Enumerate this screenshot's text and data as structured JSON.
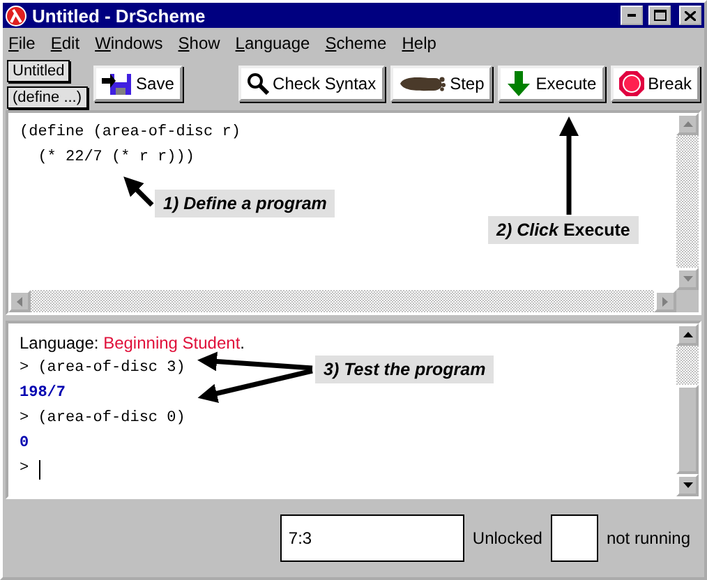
{
  "window": {
    "title": "Untitled - DrScheme"
  },
  "menu": [
    "File",
    "Edit",
    "Windows",
    "Show",
    "Language",
    "Scheme",
    "Help"
  ],
  "file_buttons": [
    "Untitled",
    "(define ...)"
  ],
  "toolbar": [
    {
      "kind": "save",
      "label": "Save"
    },
    {
      "kind": "check",
      "label": "Check Syntax"
    },
    {
      "kind": "step",
      "label": "Step"
    },
    {
      "kind": "execute",
      "label": "Execute"
    },
    {
      "kind": "break",
      "label": "Break"
    }
  ],
  "editor": {
    "lines": [
      "(define (area-of-disc r)",
      "  (* 22/7 (* r r)))"
    ]
  },
  "interactions": {
    "language_label": "Language:",
    "language": "Beginning Student",
    "language_end": ".",
    "lines": [
      {
        "kind": "input",
        "prompt": ">",
        "text": "(area-of-disc 3)"
      },
      {
        "kind": "result",
        "text": "198/7"
      },
      {
        "kind": "input",
        "prompt": ">",
        "text": "(area-of-disc 0)"
      },
      {
        "kind": "result",
        "text": "0"
      },
      {
        "kind": "prompt",
        "prompt": ">"
      }
    ]
  },
  "annotations": [
    {
      "text": "1) Define a program"
    },
    {
      "text": "*2) Click* Execute"
    },
    {
      "text": "3) Test the program"
    }
  ],
  "status": {
    "position": "7:3",
    "lock": "Unlocked",
    "state": "not running"
  }
}
